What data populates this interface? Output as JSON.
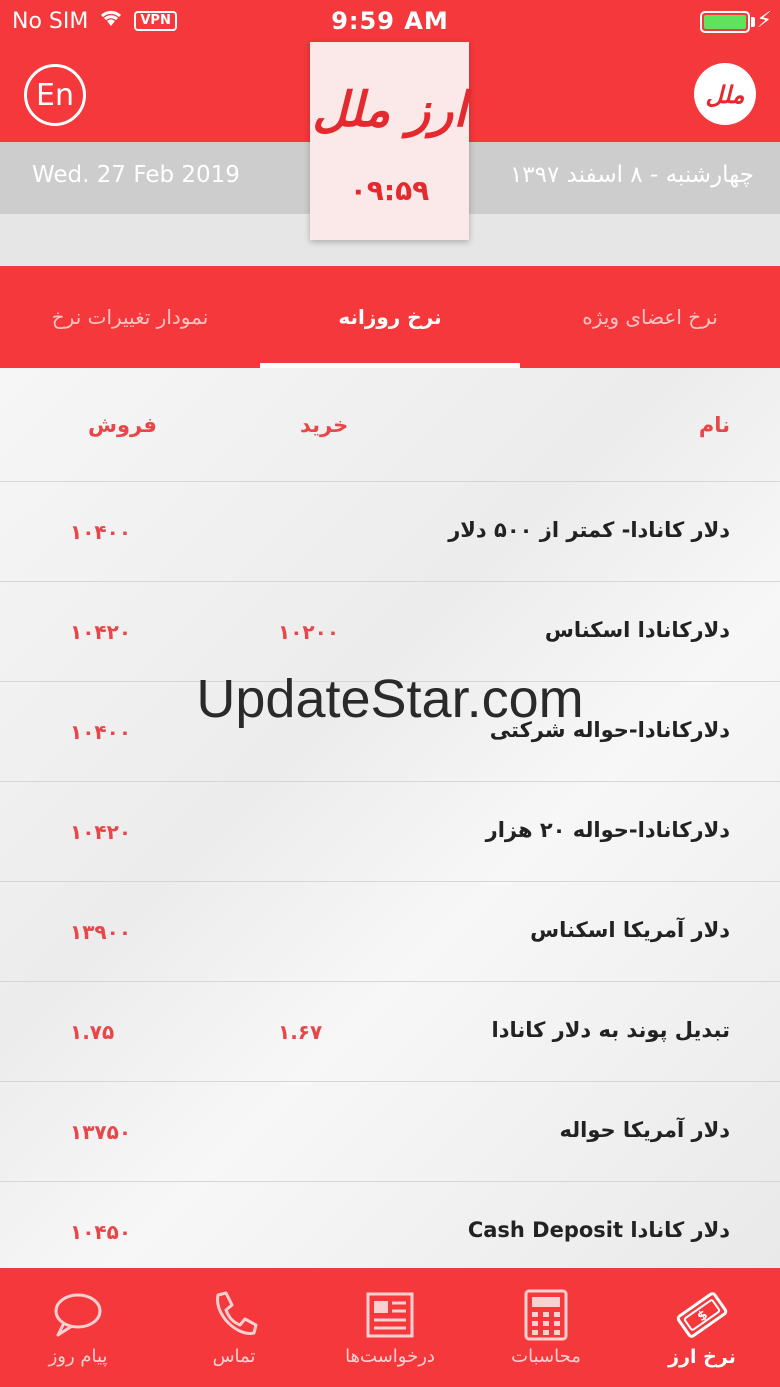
{
  "status_bar": {
    "carrier": "No SIM",
    "vpn": "VPN",
    "time": "9:59 AM",
    "battery_level": 1.0
  },
  "header": {
    "lang_button": "En",
    "logo_text": "ملل",
    "brand_title": "ارز ملل",
    "clock": "۰۹:۵۹",
    "date_en": "Wed. 27 Feb 2019",
    "date_fa": "چهارشنبه - ۸ اسفند ۱۳۹۷"
  },
  "tabs": [
    {
      "label": "نمودار تغییرات نرخ",
      "active": false
    },
    {
      "label": "نرخ روزانه",
      "active": true
    },
    {
      "label": "نرخ اعضای ویژه",
      "active": false
    }
  ],
  "table": {
    "headers": {
      "name": "نام",
      "buy": "خرید",
      "sell": "فروش"
    },
    "rows": [
      {
        "name": "دلار کانادا- کمتر از ۵۰۰ دلار",
        "buy": "",
        "sell": "۱۰۴۰۰"
      },
      {
        "name": "دلارکانادا اسکناس",
        "buy": "۱۰۲۰۰",
        "sell": "۱۰۴۲۰"
      },
      {
        "name": "دلارکانادا-حواله شرکتی",
        "buy": "",
        "sell": "۱۰۴۰۰"
      },
      {
        "name": "دلارکانادا-حواله ۲۰ هزار",
        "buy": "",
        "sell": "۱۰۴۲۰"
      },
      {
        "name": "دلار آمریکا اسکناس",
        "buy": "",
        "sell": "۱۳۹۰۰"
      },
      {
        "name": "تبدیل پوند به دلار کانادا",
        "buy": "۱.۶۷",
        "sell": "۱.۷۵"
      },
      {
        "name": "دلار آمریکا حواله",
        "buy": "",
        "sell": "۱۳۷۵۰"
      },
      {
        "name": "دلار کانادا Cash Deposit",
        "buy": "",
        "sell": "۱۰۴۵۰"
      }
    ]
  },
  "watermark": "UpdateStar.com",
  "bottom_nav": [
    {
      "label": "پیام روز",
      "icon": "chat-bubble-icon",
      "active": false
    },
    {
      "label": "تماس",
      "icon": "phone-icon",
      "active": false
    },
    {
      "label": "درخواست‌ها",
      "icon": "newspaper-icon",
      "active": false
    },
    {
      "label": "محاسبات",
      "icon": "calculator-icon",
      "active": false
    },
    {
      "label": "نرخ ارز",
      "icon": "currency-tag-icon",
      "active": true
    }
  ],
  "colors": {
    "primary_red": "#f5383c",
    "accent_red": "#e8474a",
    "battery_green": "#5ee35b"
  }
}
